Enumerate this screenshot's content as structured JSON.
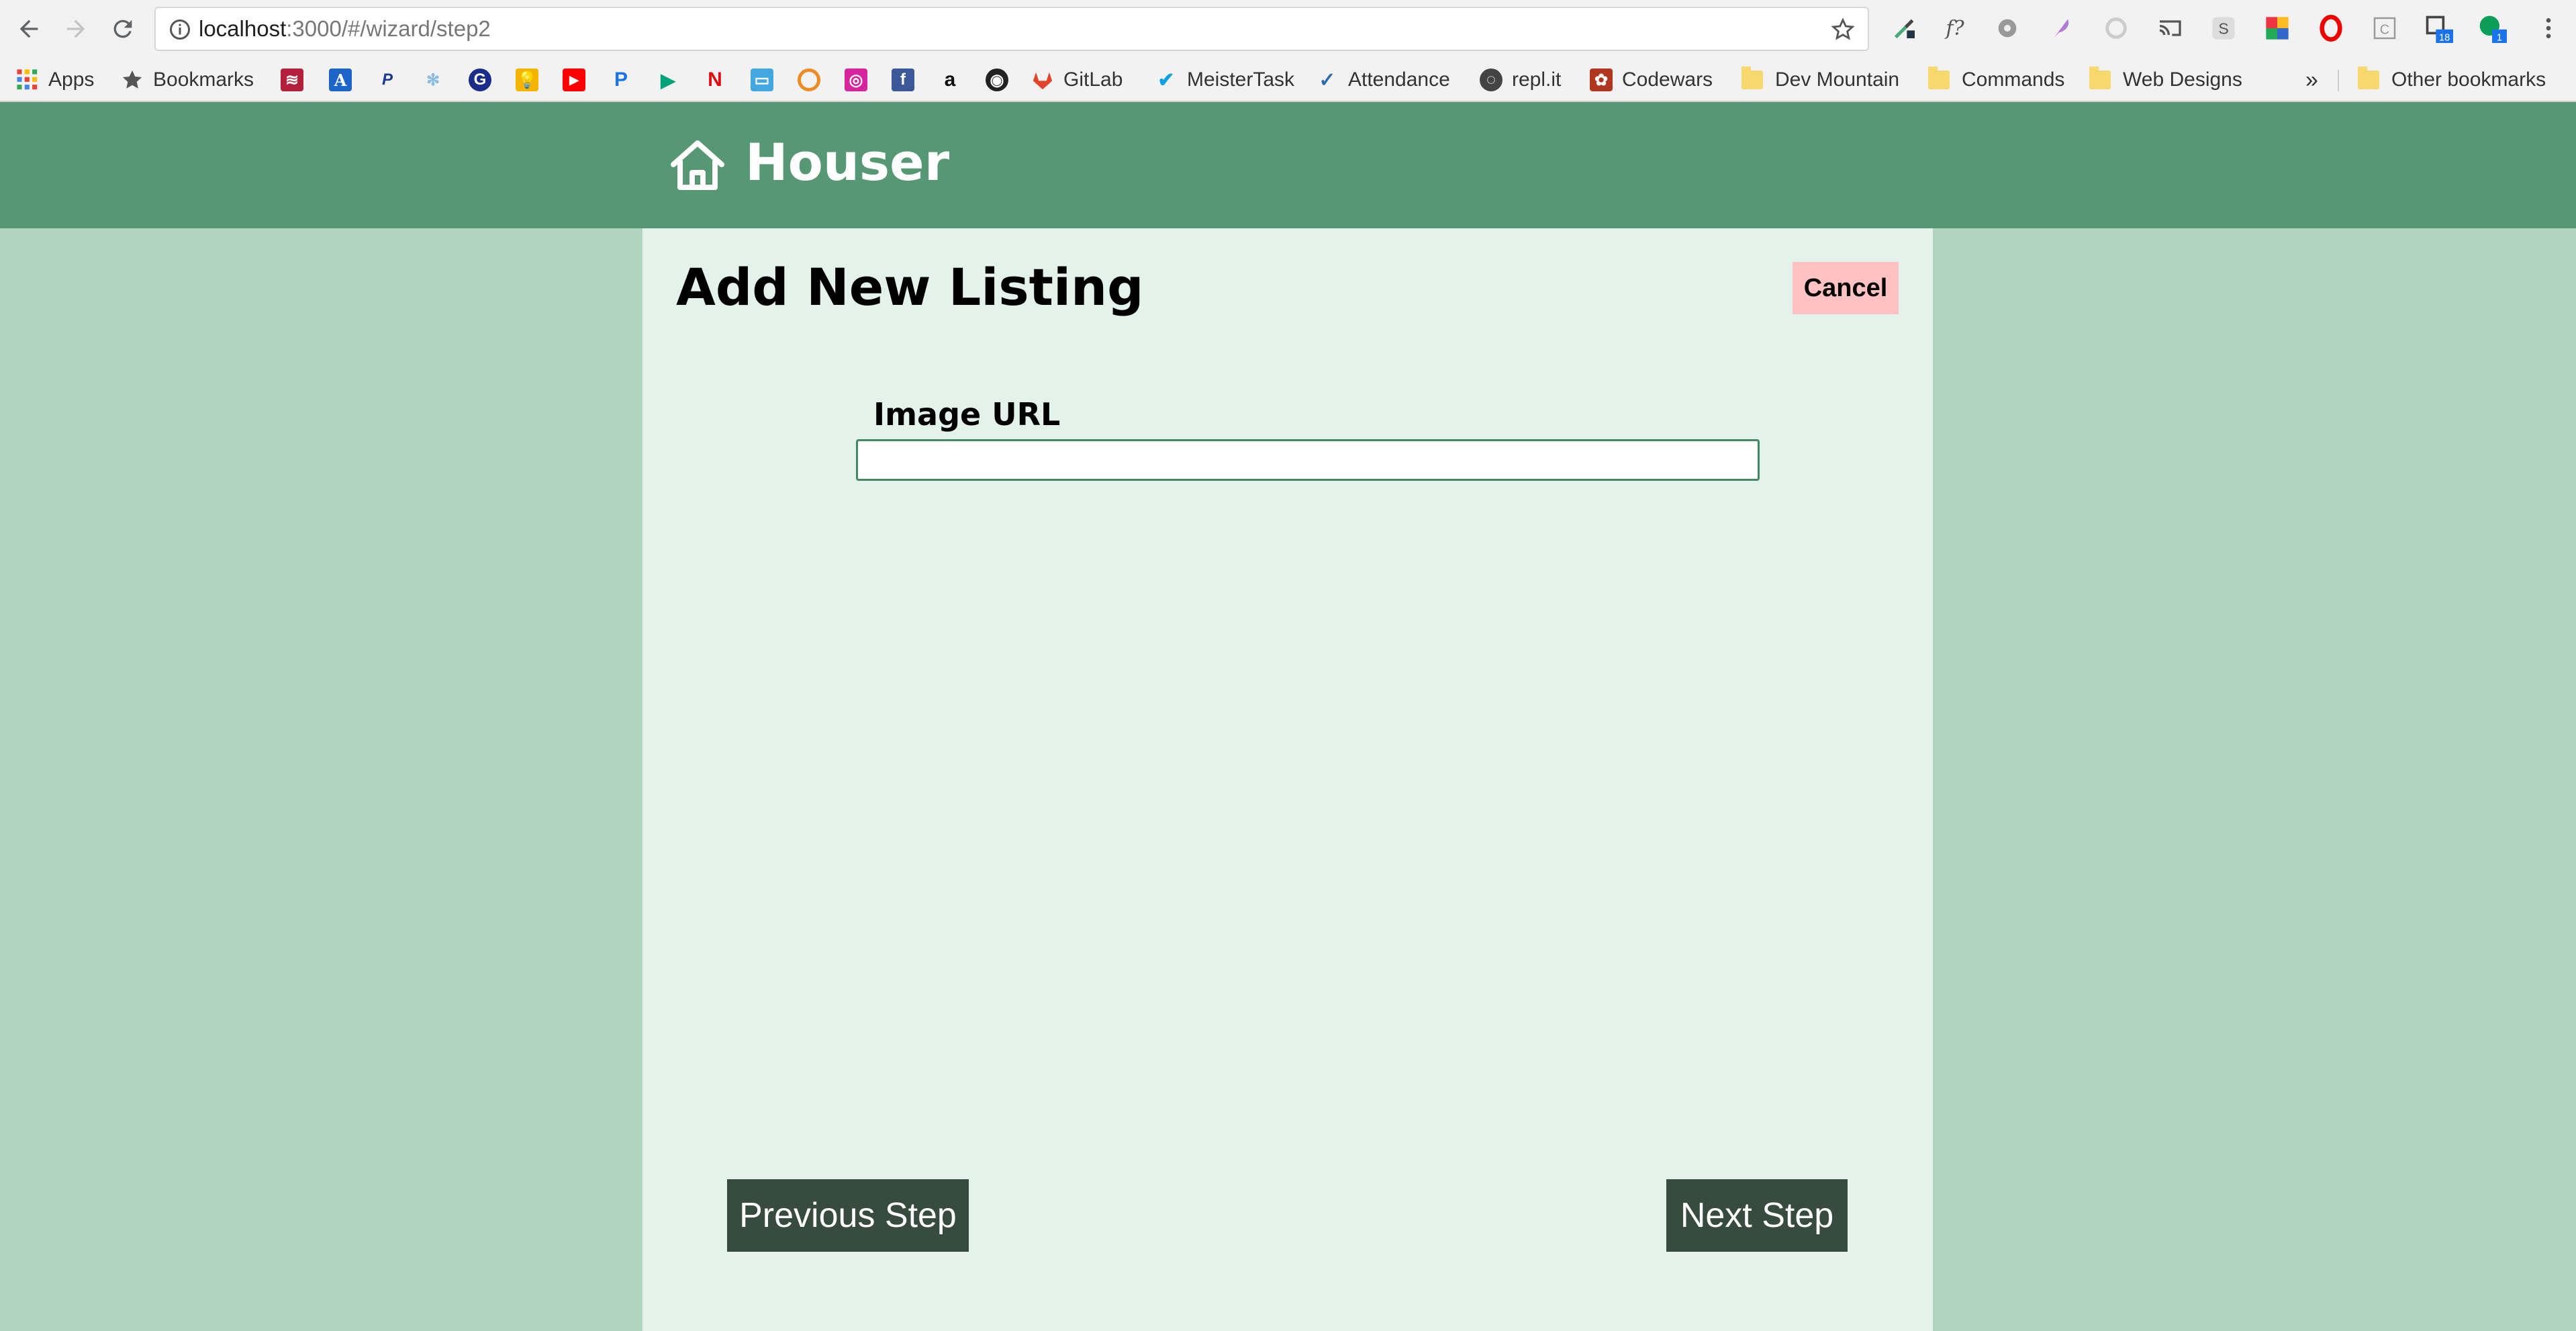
{
  "browser": {
    "url_host": "localhost",
    "url_rest": ":3000/#/wizard/step2",
    "bookmarks": {
      "apps": "Apps",
      "bookmarks": "Bookmarks",
      "gitlab": "GitLab",
      "meistertask": "MeisterTask",
      "attendance": "Attendance",
      "replit": "repl.it",
      "codewars": "Codewars",
      "dev_mountain": "Dev Mountain",
      "commands": "Commands",
      "web_designs": "Web Designs",
      "overflow": "»",
      "other": "Other bookmarks"
    },
    "extension_badges": {
      "ext_a": "18",
      "ext_b": "1"
    }
  },
  "app": {
    "brand": "Houser",
    "page_title": "Add New Listing",
    "cancel_label": "Cancel",
    "image_url_label": "Image URL",
    "image_url_value": "",
    "prev_label": "Previous Step",
    "next_label": "Next Step"
  },
  "colors": {
    "header_bg": "#559873",
    "page_bg": "#afd5bf",
    "panel_bg": "#e3f2ea",
    "cancel_bg": "#ffc1c1",
    "step_button_bg": "#374b3e",
    "input_border": "#3f8a5f"
  }
}
